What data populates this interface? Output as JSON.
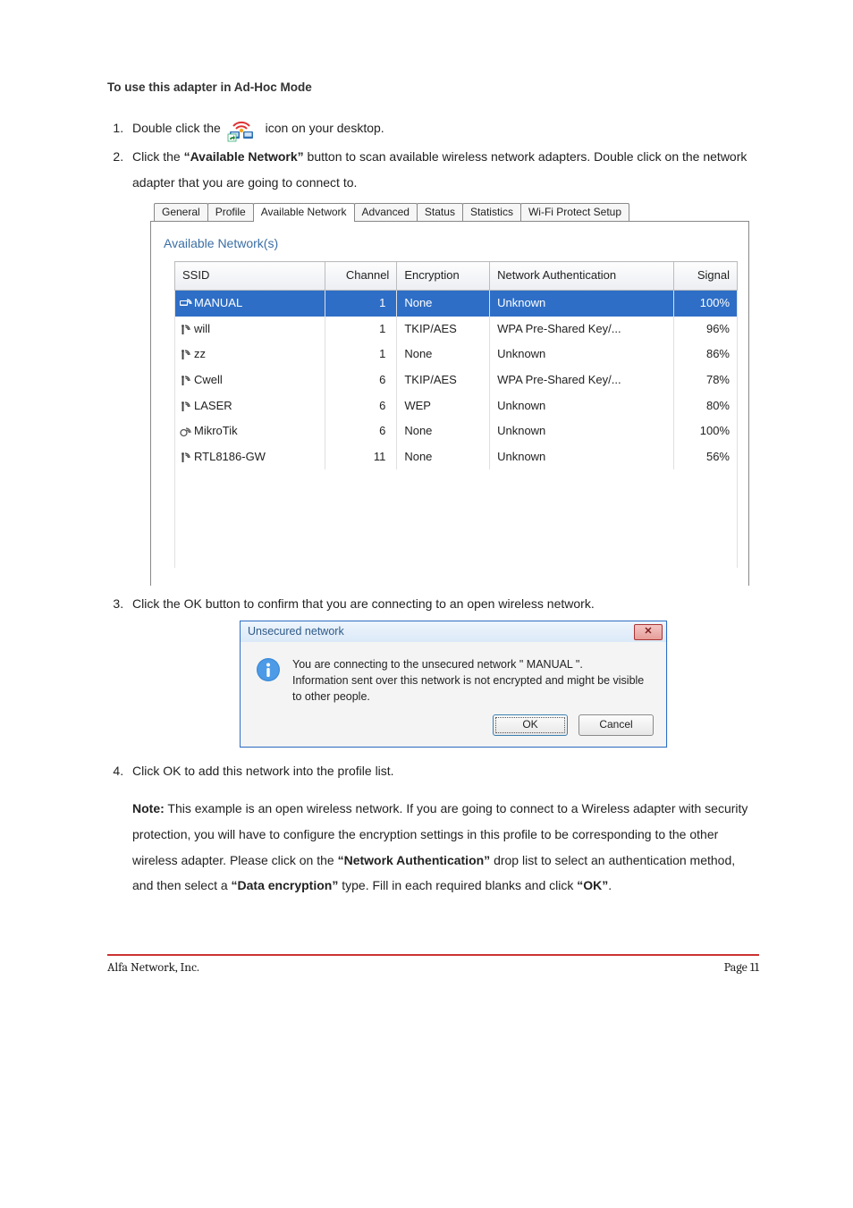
{
  "heading": "To use this adapter in Ad-Hoc Mode",
  "step1": {
    "pre": "Double click the ",
    "post": " icon on your desktop."
  },
  "step2": {
    "a": "Click the ",
    "bold": "“Available Network”",
    "b": " button to scan available wireless network adapters. Double click on the network adapter that you are going to connect to."
  },
  "tabs": {
    "general": "General",
    "profile": "Profile",
    "available_network": "Available Network",
    "advanced": "Advanced",
    "status": "Status",
    "statistics": "Statistics",
    "wps": "Wi-Fi Protect Setup"
  },
  "subheading": "Available Network(s)",
  "columns": {
    "ssid": "SSID",
    "channel": "Channel",
    "encryption": "Encryption",
    "auth": "Network Authentication",
    "signal": "Signal"
  },
  "rows": [
    {
      "ssid": "MANUAL",
      "channel": "1",
      "enc": "None",
      "auth": "Unknown",
      "signal": "100%",
      "sel": true,
      "type": "connected"
    },
    {
      "ssid": "will",
      "channel": "1",
      "enc": "TKIP/AES",
      "auth": "WPA Pre-Shared Key/...",
      "signal": "96%",
      "sel": false,
      "type": "infra"
    },
    {
      "ssid": "zz",
      "channel": "1",
      "enc": "None",
      "auth": "Unknown",
      "signal": "86%",
      "sel": false,
      "type": "infra"
    },
    {
      "ssid": "Cwell",
      "channel": "6",
      "enc": "TKIP/AES",
      "auth": "WPA Pre-Shared Key/...",
      "signal": "78%",
      "sel": false,
      "type": "infra"
    },
    {
      "ssid": "LASER",
      "channel": "6",
      "enc": "WEP",
      "auth": "Unknown",
      "signal": "80%",
      "sel": false,
      "type": "infra"
    },
    {
      "ssid": "MikroTik",
      "channel": "6",
      "enc": "None",
      "auth": "Unknown",
      "signal": "100%",
      "sel": false,
      "type": "adhoc"
    },
    {
      "ssid": "RTL8186-GW",
      "channel": "11",
      "enc": "None",
      "auth": "Unknown",
      "signal": "56%",
      "sel": false,
      "type": "infra"
    }
  ],
  "step3": "Click the OK button to confirm that you are connecting to an open wireless network.",
  "dialog": {
    "title": "Unsecured network",
    "line1": "You are connecting to the unsecured network \" MANUAL \".",
    "line2": "Information sent over this network is not encrypted and might be visible to other people.",
    "ok": "OK",
    "cancel": "Cancel"
  },
  "step4": "Click OK to add this network into the profile list.",
  "note": {
    "label": "Note:",
    "t1": " This example is an open wireless network. If you are going to connect to a Wireless adapter with security protection, you will have to configure the encryption settings in this profile to be corresponding to the other wireless adapter. Please click on the ",
    "b1": "“Network Authentication”",
    "t2": " drop list to select an authentication method, and then select a ",
    "b2": "“Data encryption”",
    "t3": " type. Fill in each required blanks and click ",
    "b3": "“OK”",
    "t4": "."
  },
  "footer": {
    "left": "Alfa Network, Inc.",
    "right": "Page 11"
  }
}
